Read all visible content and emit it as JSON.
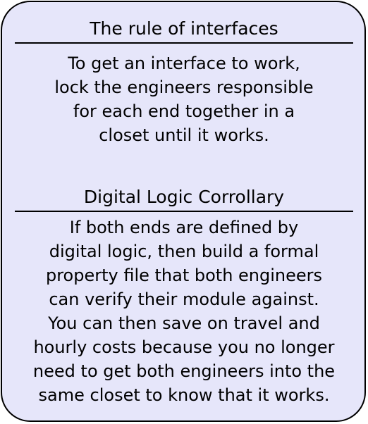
{
  "rule": {
    "heading": "The rule of interfaces",
    "lines": [
      "To get an interface to work,",
      "lock the engineers responsible",
      "for each end together in a",
      "closet until it works."
    ]
  },
  "corollary": {
    "heading": "Digital Logic Corrollary",
    "lines": [
      "If both ends are defined by",
      "digital logic, then build a formal",
      "property file that both engineers",
      "can verify their module against.",
      "You can then save on travel and",
      "hourly costs because you no longer",
      "need to get both engineers into the",
      "same closet to know that it works."
    ]
  },
  "colors": {
    "card_fill": "#e6e6fa",
    "border": "#000000",
    "text": "#000000"
  }
}
